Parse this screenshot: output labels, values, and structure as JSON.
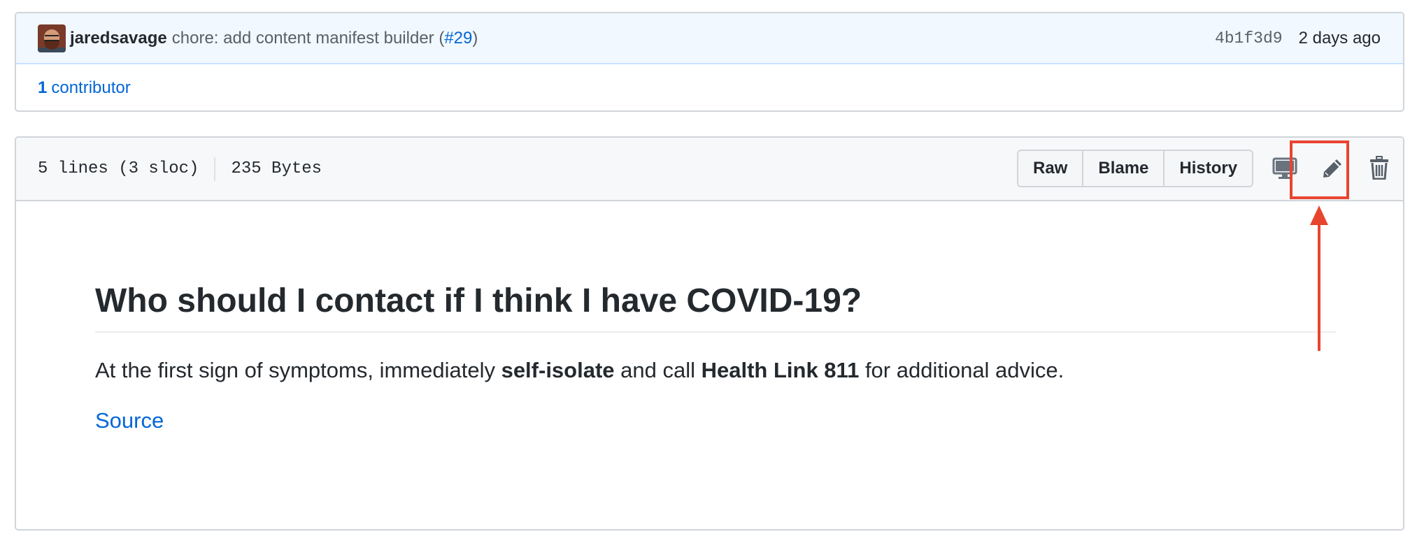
{
  "commit": {
    "author": "jaredsavage",
    "message_prefix": "chore: add content manifest builder (",
    "pr_link": "#29",
    "message_suffix": ")",
    "sha": "4b1f3d9",
    "time_ago": "2 days ago"
  },
  "contributors": {
    "count": "1",
    "label": "contributor"
  },
  "file": {
    "lines": "5 lines (3 sloc)",
    "size": "235 Bytes",
    "buttons": [
      "Raw",
      "Blame",
      "History"
    ],
    "icons": [
      "desktop-icon",
      "pencil-icon",
      "trash-icon"
    ]
  },
  "readme": {
    "heading": "Who should I contact if I think I have COVID-19?",
    "para_1": "At the first sign of symptoms, immediately ",
    "bold_1": "self-isolate",
    "para_2": " and call ",
    "bold_2": "Health Link 811",
    "para_3": " for additional advice.",
    "source_link": "Source"
  },
  "annotation": {
    "color": "#e84530"
  }
}
